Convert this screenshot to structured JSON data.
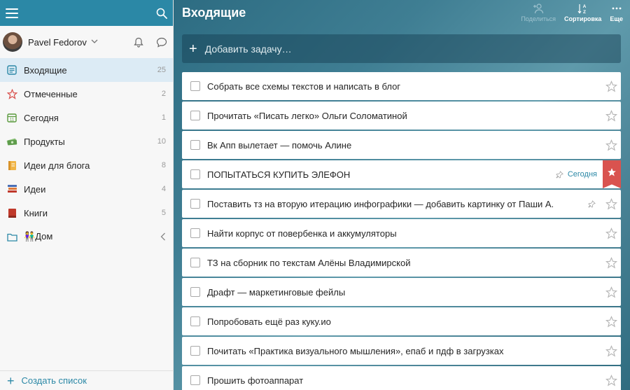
{
  "sidebar": {
    "user": {
      "name": "Pavel Fedorov"
    },
    "items": [
      {
        "label": "Входящие",
        "count": "25",
        "icon": "inbox-icon",
        "color": "#2b88a6",
        "active": true
      },
      {
        "label": "Отмеченные",
        "count": "2",
        "icon": "star-outline-icon",
        "color": "#d9534f"
      },
      {
        "label": "Сегодня",
        "count": "1",
        "icon": "calendar-icon",
        "color": "#5a9a3d"
      },
      {
        "label": "Продукты",
        "count": "10",
        "icon": "money-icon",
        "color": "#6aa35a"
      },
      {
        "label": "Идеи для блога",
        "count": "8",
        "icon": "notebook-icon",
        "color": "#e8a33a"
      },
      {
        "label": "Идеи",
        "count": "4",
        "icon": "books-icon",
        "color": "#4a6fb5"
      },
      {
        "label": "Книги",
        "count": "5",
        "icon": "book-icon",
        "color": "#c0392b"
      },
      {
        "label": "Дом",
        "count": "",
        "icon": "folder-icon",
        "color": "#2b88a6",
        "emoji": "👫"
      }
    ],
    "create_list": "Создать список"
  },
  "main": {
    "title": "Входящие",
    "toolbar": {
      "share": "Поделиться",
      "sort": "Сортировка",
      "more": "Еще"
    },
    "add_task_placeholder": "Добавить задачу…",
    "tasks": [
      {
        "title": "Собрать все схемы текстов и написать в блог",
        "starred": false
      },
      {
        "title": "Прочитать «Писать легко» Ольги Соломатиной",
        "starred": false
      },
      {
        "title": "Вк Апп вылетает — помочь Алине",
        "starred": false
      },
      {
        "title": "ПОПЫТАТЬСЯ КУПИТЬ ЭЛЕФОН",
        "starred": true,
        "due": "Сегодня",
        "pinned": true
      },
      {
        "title": "Поставить тз на вторую итерацию инфографики — добавить картинку от Паши А.",
        "starred": false,
        "pinned": true
      },
      {
        "title": "Найти корпус от повербенка и аккумуляторы",
        "starred": false
      },
      {
        "title": "ТЗ на сборник по текстам Алёны Владимирской",
        "starred": false
      },
      {
        "title": "Драфт — маркетинговые фейлы",
        "starred": false
      },
      {
        "title": "Попробовать ещё раз куку.ио",
        "starred": false
      },
      {
        "title": "Почитать «Практика визуального мышления», епаб и пдф в загрузках",
        "starred": false
      },
      {
        "title": "Прошить фотоаппарат",
        "starred": false
      }
    ]
  }
}
